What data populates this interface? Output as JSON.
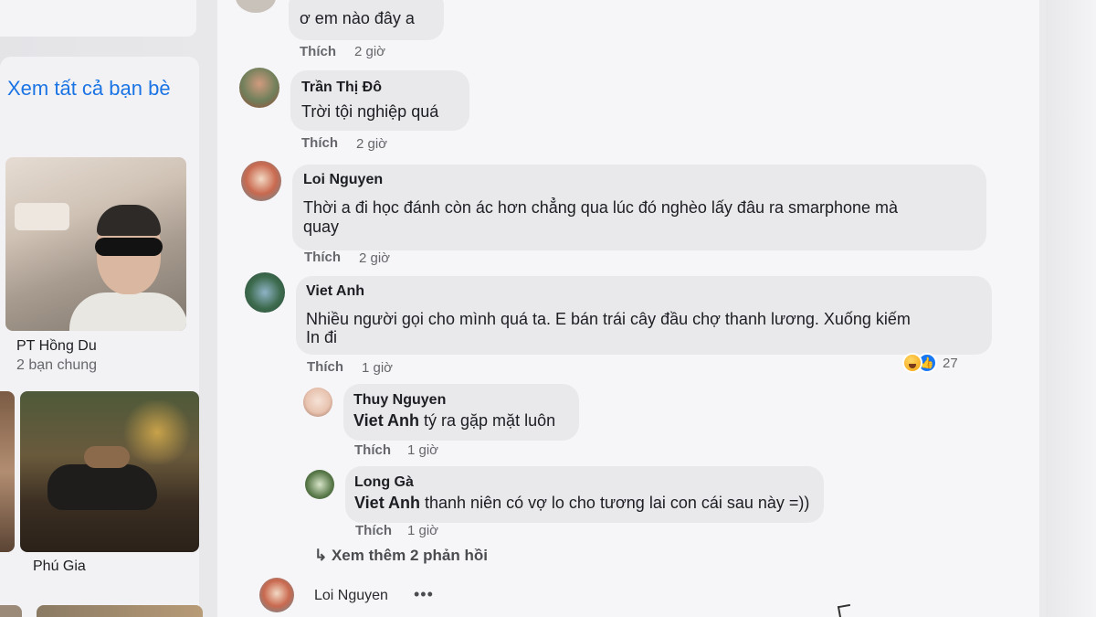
{
  "sidebar": {
    "see_all_friends": "Xem tất cả bạn bè",
    "friends": [
      {
        "name": "PT Hồng Du",
        "mutual": "2 bạn chung"
      },
      {
        "name": "Phú Gia",
        "mutual": ""
      }
    ]
  },
  "comments": [
    {
      "author": "",
      "text": "ơ em nào đây a",
      "like_label": "Thích",
      "time": "2 giờ"
    },
    {
      "author": "Trần Thị Đô",
      "text": "Trời tội nghiệp quá",
      "like_label": "Thích",
      "time": "2 giờ"
    },
    {
      "author": "Loi Nguyen",
      "text_line1": "Thời a đi học đánh còn ác hơn chẳng qua lúc đó nghèo lấy đâu ra smarphone mà",
      "text_line2": "quay",
      "like_label": "Thích",
      "time": "2 giờ"
    },
    {
      "author": "Viet Anh",
      "text_line1": "Nhiều người gọi cho mình quá ta. E bán trái cây đầu chợ thanh lương. Xuống kiếm",
      "text_line2": "In đi",
      "like_label": "Thích",
      "time": "1 giờ",
      "reaction_count": "27",
      "reaction_icons": [
        "haha-icon",
        "like-icon"
      ],
      "replies": [
        {
          "author": "Thuy Nguyen",
          "mention": "Viet Anh",
          "text": " tý ra gặp mặt luôn",
          "like_label": "Thích",
          "time": "1 giờ"
        },
        {
          "author": "Long Gà",
          "mention": "Viet Anh",
          "text": " thanh niên có vợ lo cho tương lai con cái sau này =))",
          "like_label": "Thích",
          "time": "1 giờ"
        }
      ],
      "more_replies": "↳ Xem thêm 2 phản hồi"
    },
    {
      "author": "Loi Nguyen",
      "options": "•••"
    }
  ],
  "colors": {
    "link_blue": "#1b74e4",
    "bubble": "#e9e9ec",
    "secondary_text": "#65676b"
  }
}
